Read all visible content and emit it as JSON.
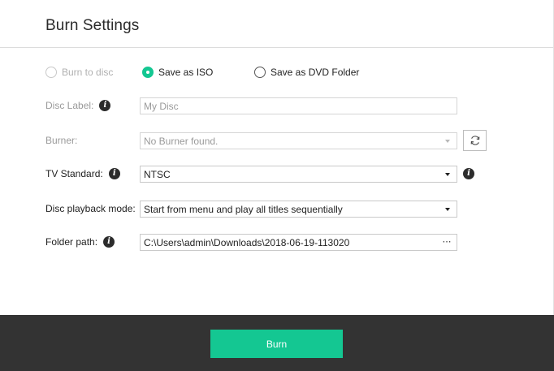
{
  "dialog": {
    "title": "Burn Settings"
  },
  "output_options": [
    {
      "label": "Burn to disc",
      "state": "disabled"
    },
    {
      "label": "Save as ISO",
      "state": "checked"
    },
    {
      "label": "Save as DVD Folder",
      "state": "unchecked"
    }
  ],
  "disc_label": {
    "label": "Disc Label:",
    "value": "My Disc"
  },
  "burner": {
    "label": "Burner:",
    "selected": "No Burner found."
  },
  "tv_standard": {
    "label": "TV Standard:",
    "selected": "NTSC"
  },
  "playback_mode": {
    "label": "Disc playback mode:",
    "selected": "Start from menu and play all titles sequentially"
  },
  "folder_path": {
    "label": "Folder path:",
    "value": "C:\\Users\\admin\\Downloads\\2018-06-19-113020",
    "browse_glyph": "⋯"
  },
  "footer": {
    "burn_label": "Burn"
  },
  "colors": {
    "accent": "#14c792",
    "footer_bg": "#333333"
  },
  "icons": [
    "info-icon",
    "refresh-icon",
    "chevron-down-icon",
    "ellipsis-icon"
  ]
}
